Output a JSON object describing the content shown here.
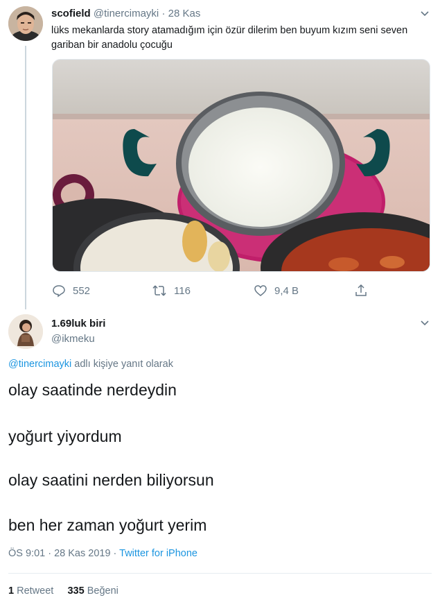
{
  "tweet": {
    "author_name": "scofield",
    "author_handle": "@tinercimayki",
    "separator": "·",
    "date": "28 Kas",
    "text": "lüks mekanlarda story atamadığım için özür dilerim ben buyum kızım seni seven gariban bir anadolu çocuğu",
    "actions": {
      "replies": "552",
      "retweets": "116",
      "likes": "9,4 B"
    },
    "media_icon": "photo-rice-yogurt-pot"
  },
  "reply": {
    "author_name": "1.69luk biri",
    "author_handle": "@ikmeku",
    "reply_mention": "@tinercimayki",
    "reply_suffix": "adlı kişiye yanıt olarak",
    "lines": [
      "olay saatinde nerdeydin",
      "yoğurt yiyordum",
      "olay saatini nerden biliyorsun",
      "ben her zaman yoğurt yerim"
    ],
    "time": "ÖS 9:01 · 28 Kas 2019",
    "source_separator": " · ",
    "source": "Twitter for iPhone",
    "retweet_count": "1",
    "retweet_label": "Retweet",
    "like_count": "335",
    "like_label": "Beğeni"
  },
  "colors": {
    "link": "#1b95e0",
    "muted": "#657786",
    "text": "#14171a",
    "line": "#ccd6dd"
  }
}
